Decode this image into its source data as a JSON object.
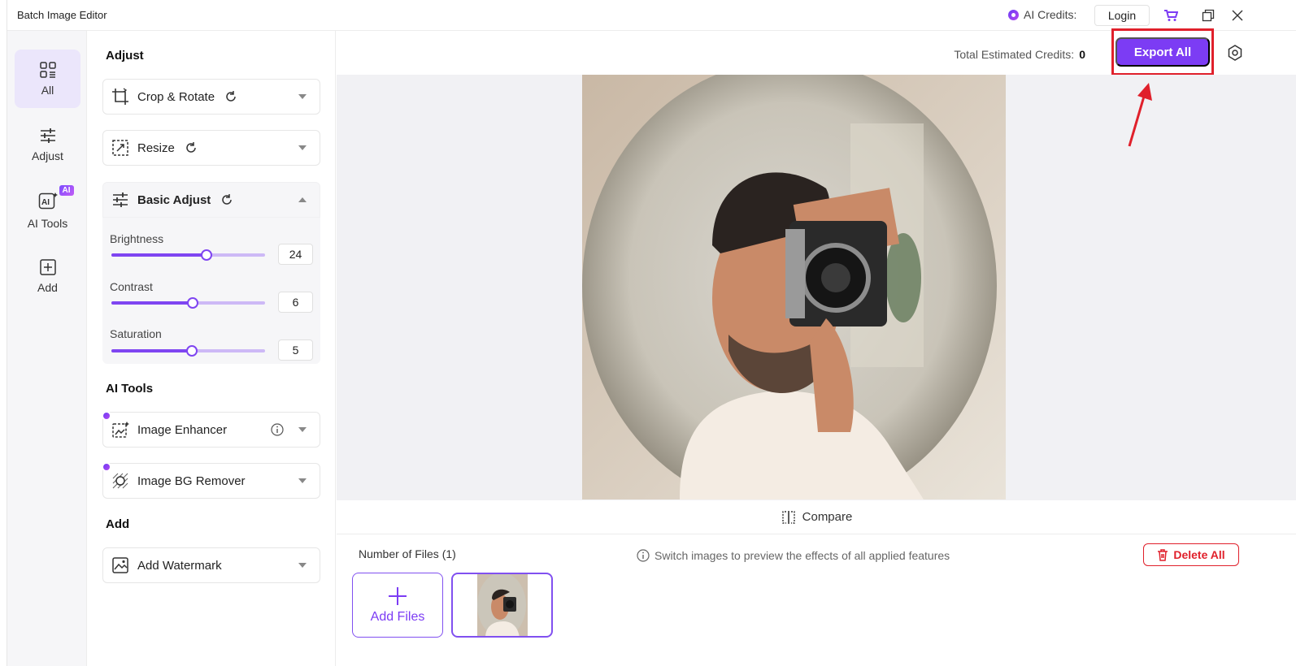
{
  "window": {
    "title": "Batch Image Editor",
    "credits_label": "AI Credits:",
    "login_label": "Login"
  },
  "rail": {
    "items": [
      {
        "label": "All",
        "icon": "grid-icon",
        "active": true
      },
      {
        "label": "Adjust",
        "icon": "sliders-icon"
      },
      {
        "label": "AI Tools",
        "icon": "ai-icon",
        "badge": "AI"
      },
      {
        "label": "Add",
        "icon": "plus-box-icon"
      }
    ]
  },
  "panel": {
    "adjust_title": "Adjust",
    "crop_label": "Crop & Rotate",
    "resize_label": "Resize",
    "basic_label": "Basic Adjust",
    "sliders": [
      {
        "label": "Brightness",
        "value": "24",
        "position": 0.62
      },
      {
        "label": "Contrast",
        "value": "6",
        "position": 0.53
      },
      {
        "label": "Saturation",
        "value": "5",
        "position": 0.525
      }
    ],
    "ai_title": "AI Tools",
    "enhancer_label": "Image Enhancer",
    "bg_remover_label": "Image BG Remover",
    "add_title": "Add",
    "watermark_label": "Add Watermark"
  },
  "main": {
    "est_label": "Total Estimated Credits:",
    "est_value": "0",
    "export_label": "Export All",
    "compare_label": "Compare",
    "nfiles_label": "Number of Files (1)",
    "hint_label": "Switch images to preview the effects of all applied features",
    "delete_label": "Delete All",
    "add_files_label": "Add Files"
  },
  "colors": {
    "accent": "#7c3cf4",
    "highlight": "#e0202b",
    "rail_active": "#ebe6fb"
  }
}
